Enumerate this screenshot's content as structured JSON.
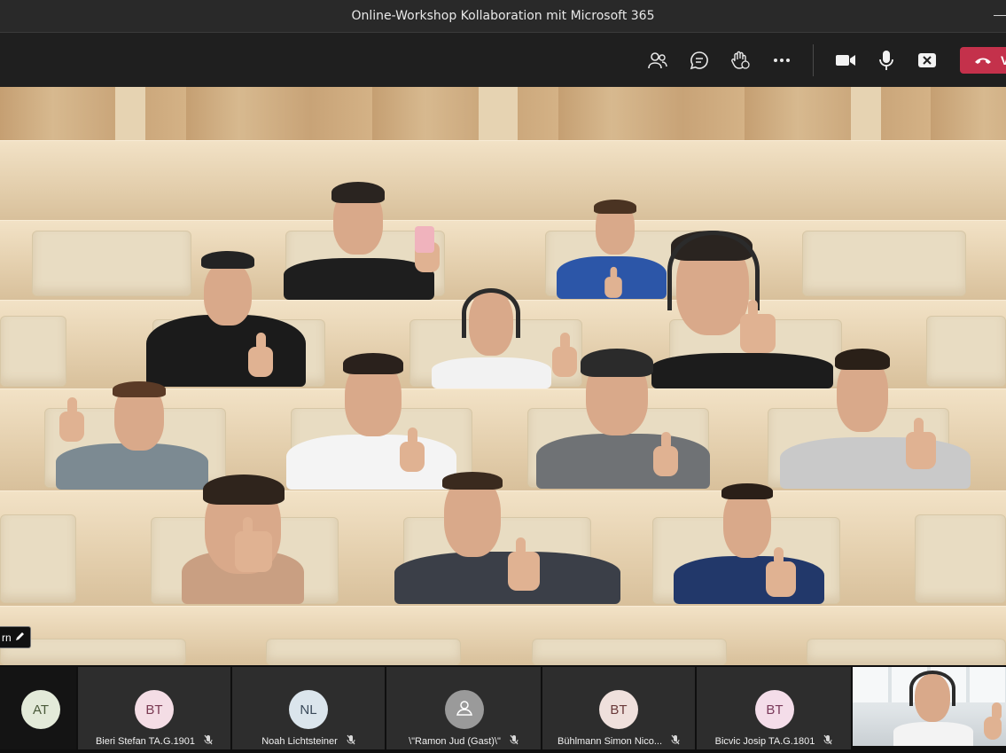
{
  "window": {
    "title": "Online-Workshop Kollaboration mit Microsoft 365"
  },
  "toolbar": {
    "icons": [
      "people-icon",
      "chat-icon",
      "raise-hand-icon",
      "more-options-icon",
      "camera-icon",
      "microphone-icon",
      "share-tray-icon",
      "hang-up-icon"
    ],
    "leave_label": "V"
  },
  "stage": {
    "name_tag_fragment": "rn"
  },
  "roster": {
    "tiles": [
      {
        "initials": "AT",
        "name": "",
        "avatar_color": "#e3ead9",
        "initials_color": "#4a5a3a"
      },
      {
        "initials": "BT",
        "name": "Bieri Stefan TA.G.1901",
        "avatar_color": "#f4dde5",
        "initials_color": "#7a3a52"
      },
      {
        "initials": "NL",
        "name": "Noah Lichtsteiner",
        "avatar_color": "#dbe5ec",
        "initials_color": "#3a4a5a"
      },
      {
        "initials": "",
        "name": "\\\"Ramon Jud (Gast)\\\"",
        "avatar_color": "#9a9a9a",
        "initials_color": "#ffffff"
      },
      {
        "initials": "BT",
        "name": "Bühlmann Simon Nico...",
        "avatar_color": "#efe0dc",
        "initials_color": "#6a3a3a"
      },
      {
        "initials": "BT",
        "name": "Bicvic Josip TA.G.1801",
        "avatar_color": "#f4dde9",
        "initials_color": "#7a3a5a"
      }
    ]
  },
  "colors": {
    "leave_button": "#c4314b",
    "toolbar_bg": "#1f1f1f",
    "titlebar_bg": "#292929"
  }
}
